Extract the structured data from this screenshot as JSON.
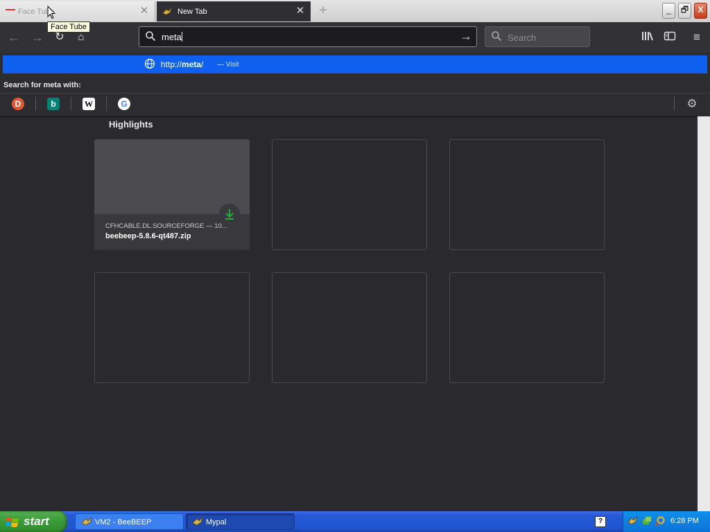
{
  "tabs": [
    {
      "title": "Face Tube",
      "active": false
    },
    {
      "title": "New Tab",
      "active": true
    }
  ],
  "tooltip": "Face Tube",
  "window_buttons": {
    "minimize": "_",
    "maximize": "🗗",
    "close": "X"
  },
  "urlbar": {
    "value": "meta"
  },
  "searchbox": {
    "placeholder": "Search"
  },
  "suggestion": {
    "url_prefix": "http://",
    "url_bold": "meta",
    "url_suffix": "/",
    "separator": "—",
    "action": "Visit"
  },
  "search_with_label": "Search for meta with:",
  "engines": [
    {
      "name": "duckduckgo",
      "glyph": "D"
    },
    {
      "name": "bing",
      "glyph": "b"
    },
    {
      "name": "wikipedia",
      "glyph": "W"
    },
    {
      "name": "google",
      "glyph": "G"
    }
  ],
  "highlights": {
    "heading": "Highlights",
    "card": {
      "host": "CFHCABLE.DL.SOURCEFORGE — 10...",
      "title": "beebeep-5.8.6-qt487.zip"
    }
  },
  "taskbar": {
    "start_label": "start",
    "tasks": [
      {
        "label": "VM2 - BeeBEEP"
      },
      {
        "label": "Mypal"
      }
    ],
    "help_glyph": "?",
    "clock": "6:28 PM"
  },
  "colors": {
    "accent": "#1060f0",
    "content_bg": "#2a2a2e",
    "toolbar_bg": "#323236",
    "download_green": "#21b136"
  }
}
